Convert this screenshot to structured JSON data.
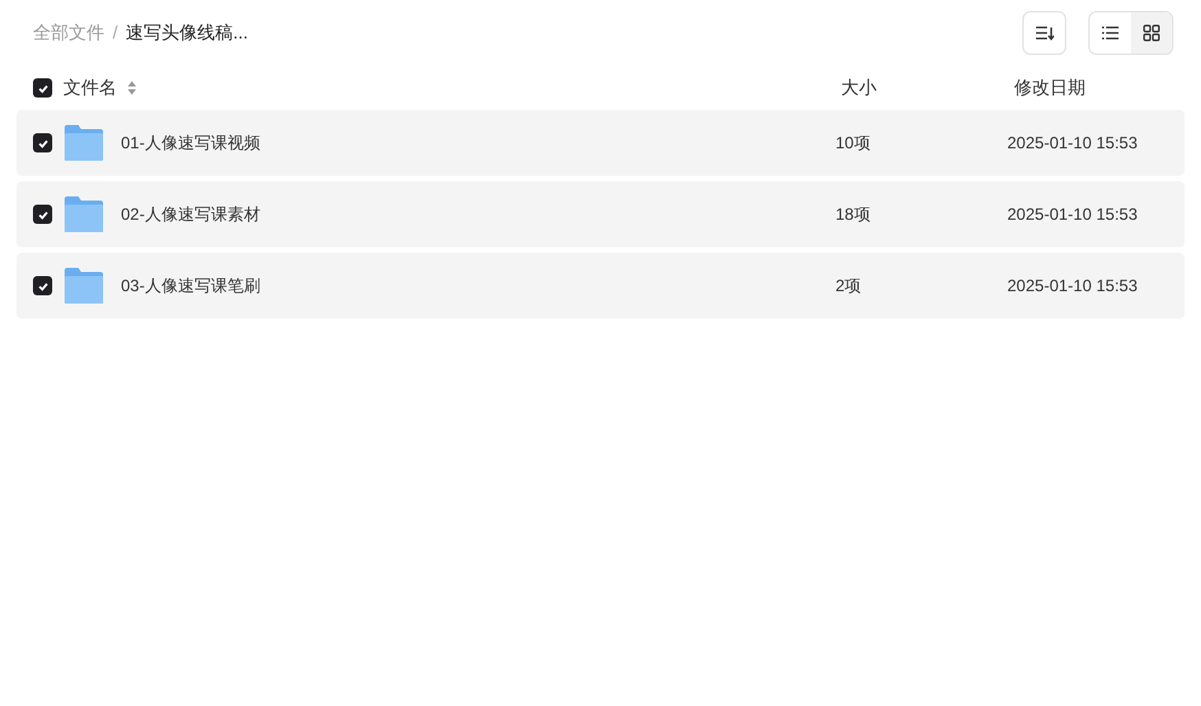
{
  "breadcrumb": [
    {
      "label": "全部文件",
      "current": false
    },
    {
      "label": "速写头像线稿...",
      "current": true
    }
  ],
  "breadcrumb_separator": "/",
  "view_modes": [
    {
      "kind": "list",
      "selected": true
    },
    {
      "kind": "grid",
      "selected": false
    }
  ],
  "header": {
    "checked": true,
    "columns": [
      "文件名",
      "大小",
      "修改日期"
    ]
  },
  "rows": [
    {
      "checked": true,
      "name": "01-人像速写课视频",
      "size": "10项",
      "date": "2025-01-10 15:53"
    },
    {
      "checked": true,
      "name": "02-人像速写课素材",
      "size": "18项",
      "date": "2025-01-10 15:53"
    },
    {
      "checked": true,
      "name": "03-人像速写课笔刷",
      "size": "2项",
      "date": "2025-01-10 15:53"
    }
  ]
}
